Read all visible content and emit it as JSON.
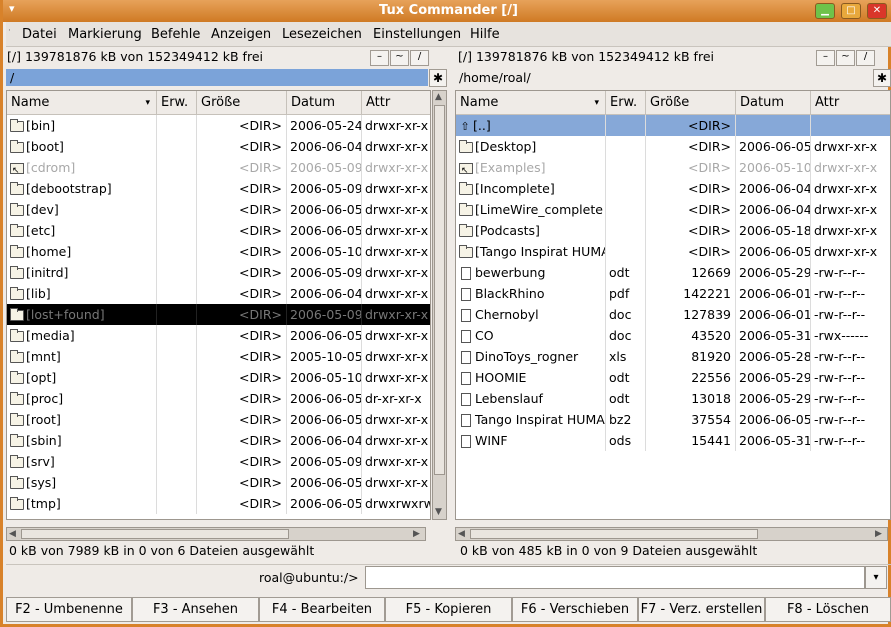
{
  "window": {
    "title": "Tux Commander  [/]"
  },
  "menu": [
    "Datei",
    "Markierung",
    "Befehle",
    "Anzeigen",
    "Lesezeichen",
    "Einstellungen",
    "Hilfe"
  ],
  "columns": [
    "Name",
    "Erw.",
    "Größe",
    "Datum",
    "Attr"
  ],
  "left": {
    "free": "[/] 139781876 kB von 152349412 kB frei",
    "path": "/",
    "status": "0 kB von 7989 kB in 0 von 6 Dateien ausgewählt",
    "rows": [
      {
        "icon": "folder",
        "name": "[bin]",
        "ext": "",
        "size": "<DIR>",
        "date": "2006-05-24",
        "attr": "drwxr-xr-x"
      },
      {
        "icon": "folder",
        "name": "[boot]",
        "ext": "",
        "size": "<DIR>",
        "date": "2006-06-04",
        "attr": "drwxr-xr-x"
      },
      {
        "icon": "link",
        "name": "[cdrom]",
        "ext": "",
        "size": "<DIR>",
        "date": "2006-05-09",
        "attr": "drwxr-xr-x",
        "state": "dim"
      },
      {
        "icon": "folder",
        "name": "[debootstrap]",
        "ext": "",
        "size": "<DIR>",
        "date": "2006-05-09",
        "attr": "drwxr-xr-x"
      },
      {
        "icon": "folder",
        "name": "[dev]",
        "ext": "",
        "size": "<DIR>",
        "date": "2006-06-05",
        "attr": "drwxr-xr-x"
      },
      {
        "icon": "folder",
        "name": "[etc]",
        "ext": "",
        "size": "<DIR>",
        "date": "2006-06-05",
        "attr": "drwxr-xr-x"
      },
      {
        "icon": "folder",
        "name": "[home]",
        "ext": "",
        "size": "<DIR>",
        "date": "2006-05-10",
        "attr": "drwxr-xr-x"
      },
      {
        "icon": "folder",
        "name": "[initrd]",
        "ext": "",
        "size": "<DIR>",
        "date": "2006-05-09",
        "attr": "drwxr-xr-x"
      },
      {
        "icon": "folder",
        "name": "[lib]",
        "ext": "",
        "size": "<DIR>",
        "date": "2006-06-04",
        "attr": "drwxr-xr-x"
      },
      {
        "icon": "folder",
        "name": "[lost+found]",
        "ext": "",
        "size": "<DIR>",
        "date": "2006-05-09",
        "attr": "drwxr-xr-x",
        "state": "sel"
      },
      {
        "icon": "folder",
        "name": "[media]",
        "ext": "",
        "size": "<DIR>",
        "date": "2006-06-05",
        "attr": "drwxr-xr-x"
      },
      {
        "icon": "folder",
        "name": "[mnt]",
        "ext": "",
        "size": "<DIR>",
        "date": "2005-10-05",
        "attr": "drwxr-xr-x"
      },
      {
        "icon": "folder",
        "name": "[opt]",
        "ext": "",
        "size": "<DIR>",
        "date": "2006-05-10",
        "attr": "drwxr-xr-x"
      },
      {
        "icon": "folder",
        "name": "[proc]",
        "ext": "",
        "size": "<DIR>",
        "date": "2006-06-05",
        "attr": "dr-xr-xr-x"
      },
      {
        "icon": "folder",
        "name": "[root]",
        "ext": "",
        "size": "<DIR>",
        "date": "2006-06-05",
        "attr": "drwxr-xr-x"
      },
      {
        "icon": "folder",
        "name": "[sbin]",
        "ext": "",
        "size": "<DIR>",
        "date": "2006-06-04",
        "attr": "drwxr-xr-x"
      },
      {
        "icon": "folder",
        "name": "[srv]",
        "ext": "",
        "size": "<DIR>",
        "date": "2006-05-09",
        "attr": "drwxr-xr-x"
      },
      {
        "icon": "folder",
        "name": "[sys]",
        "ext": "",
        "size": "<DIR>",
        "date": "2006-06-05",
        "attr": "drwxr-xr-x"
      },
      {
        "icon": "folder",
        "name": "[tmp]",
        "ext": "",
        "size": "<DIR>",
        "date": "2006-06-05",
        "attr": "drwxrwxrw"
      }
    ]
  },
  "right": {
    "free": "[/] 139781876 kB von 152349412 kB frei",
    "path": "/home/roal/",
    "status": "0 kB von 485 kB in 0 von 9 Dateien ausgewählt",
    "rows": [
      {
        "icon": "up",
        "name": "[..]",
        "ext": "",
        "size": "<DIR>",
        "date": "",
        "attr": "",
        "state": "cur"
      },
      {
        "icon": "folder",
        "name": "[Desktop]",
        "ext": "",
        "size": "<DIR>",
        "date": "2006-06-05",
        "attr": "drwxr-xr-x"
      },
      {
        "icon": "link",
        "name": "[Examples]",
        "ext": "",
        "size": "<DIR>",
        "date": "2006-05-10",
        "attr": "drwxr-xr-x",
        "state": "dim"
      },
      {
        "icon": "folder",
        "name": "[Incomplete]",
        "ext": "",
        "size": "<DIR>",
        "date": "2006-06-04",
        "attr": "drwxr-xr-x"
      },
      {
        "icon": "folder",
        "name": "[LimeWire_complete",
        "ext": "",
        "size": "<DIR>",
        "date": "2006-06-04",
        "attr": "drwxr-xr-x"
      },
      {
        "icon": "folder",
        "name": "[Podcasts]",
        "ext": "",
        "size": "<DIR>",
        "date": "2006-05-18",
        "attr": "drwxr-xr-x"
      },
      {
        "icon": "folder",
        "name": "[Tango Inspirat HUMA",
        "ext": "",
        "size": "<DIR>",
        "date": "2006-06-05",
        "attr": "drwxr-xr-x"
      },
      {
        "icon": "file",
        "name": "bewerbung",
        "ext": "odt",
        "size": "12669",
        "date": "2006-05-29",
        "attr": "-rw-r--r--"
      },
      {
        "icon": "file",
        "name": "BlackRhino",
        "ext": "pdf",
        "size": "142221",
        "date": "2006-06-01",
        "attr": "-rw-r--r--"
      },
      {
        "icon": "file",
        "name": "Chernobyl",
        "ext": "doc",
        "size": "127839",
        "date": "2006-06-01",
        "attr": "-rw-r--r--"
      },
      {
        "icon": "file",
        "name": "CO",
        "ext": "doc",
        "size": "43520",
        "date": "2006-05-31",
        "attr": "-rwx------"
      },
      {
        "icon": "file",
        "name": "DinoToys_rogner",
        "ext": "xls",
        "size": "81920",
        "date": "2006-05-28",
        "attr": "-rw-r--r--"
      },
      {
        "icon": "file",
        "name": "HOOMIE",
        "ext": "odt",
        "size": "22556",
        "date": "2006-05-29",
        "attr": "-rw-r--r--"
      },
      {
        "icon": "file",
        "name": "Lebenslauf",
        "ext": "odt",
        "size": "13018",
        "date": "2006-05-29",
        "attr": "-rw-r--r--"
      },
      {
        "icon": "file",
        "name": "Tango Inspirat HUMA",
        "ext": "bz2",
        "size": "37554",
        "date": "2006-06-05",
        "attr": "-rw-r--r--"
      },
      {
        "icon": "file",
        "name": "WINF",
        "ext": "ods",
        "size": "15441",
        "date": "2006-05-31",
        "attr": "-rw-r--r--"
      }
    ]
  },
  "command": {
    "prompt": "roal@ubuntu:/>",
    "value": ""
  },
  "panel_buttons": [
    "–",
    "~",
    "/"
  ],
  "fkeys": [
    "F2 - Umbenenne",
    "F3 - Ansehen",
    "F4 - Bearbeiten",
    "F5 - Kopieren",
    "F6 - Verschieben",
    "F7 - Verz. erstellen",
    "F8 - Löschen"
  ]
}
